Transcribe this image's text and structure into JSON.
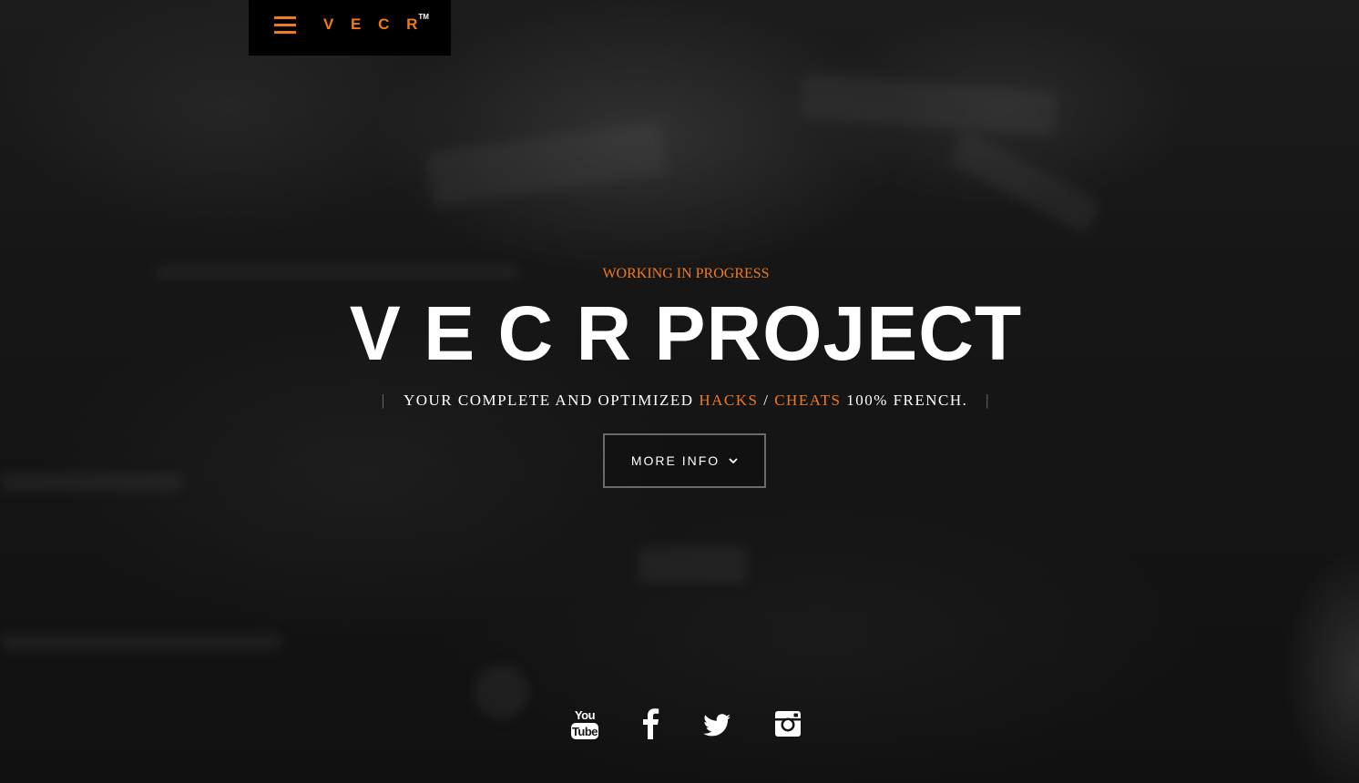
{
  "nav": {
    "brand": "V E C R",
    "brand_mark": "TM",
    "menu_icon": "hamburger-menu-icon"
  },
  "hero": {
    "kicker": "WORKING IN PROGRESS",
    "title": "V E C R PROJECT",
    "tagline": {
      "prefix": "YOUR COMPLETE AND OPTIMIZED",
      "hacks": "HACKS",
      "slash": "/",
      "cheats": "CHEATS",
      "suffix": "100% FRENCH.",
      "divider": "|"
    },
    "button": {
      "label": "MORE INFO",
      "icon": "chevron-down-icon"
    }
  },
  "social": [
    {
      "name": "youtube",
      "icon": "youtube-icon"
    },
    {
      "name": "facebook",
      "icon": "facebook-icon"
    },
    {
      "name": "twitter",
      "icon": "twitter-icon"
    },
    {
      "name": "instagram",
      "icon": "instagram-icon"
    }
  ],
  "colors": {
    "accent": "#f07a1d",
    "background": "#151515",
    "navbar": "#000000",
    "text": "#ffffff"
  }
}
